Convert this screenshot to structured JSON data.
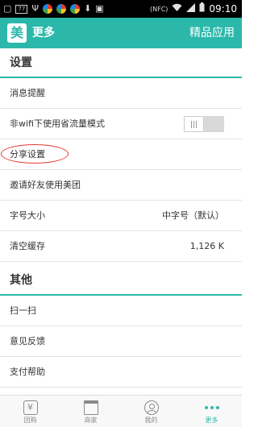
{
  "status_bar": {
    "notif_count": "77",
    "nfc": "(NFC)",
    "time": "09:10"
  },
  "header": {
    "logo_char": "美",
    "title": "更多",
    "right_link": "精品应用"
  },
  "sections": [
    {
      "title": "设置",
      "rows": [
        {
          "label": "消息提醒"
        },
        {
          "label": "非wifi下使用省流量模式",
          "toggle": true,
          "toggle_on": false
        },
        {
          "label": "分享设置",
          "highlighted": true
        },
        {
          "label": "邀请好友使用美团"
        },
        {
          "label": "字号大小",
          "value": "中字号（默认）"
        },
        {
          "label": "清空缓存",
          "value": "1,126 K"
        }
      ]
    },
    {
      "title": "其他",
      "rows": [
        {
          "label": "扫一扫"
        },
        {
          "label": "意见反馈"
        },
        {
          "label": "支付帮助"
        }
      ]
    }
  ],
  "tabs": [
    {
      "label": "团购",
      "icon": "tuangou-icon",
      "glyph": "¥"
    },
    {
      "label": "商家",
      "icon": "shop-icon"
    },
    {
      "label": "我的",
      "icon": "user-icon"
    },
    {
      "label": "更多",
      "icon": "more-icon",
      "active": true
    }
  ],
  "colors": {
    "accent": "#2bb8aa",
    "highlight_annotation": "#e53935"
  }
}
